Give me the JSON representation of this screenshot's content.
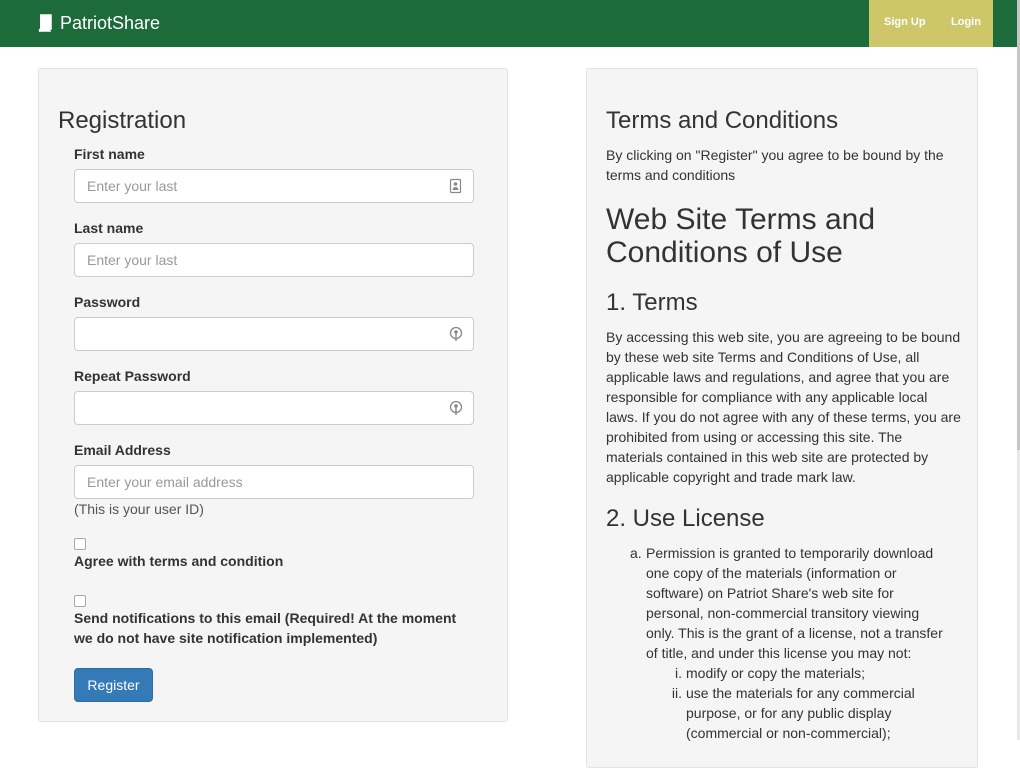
{
  "navbar": {
    "brand": "PatriotShare",
    "signup_label": "Sign Up",
    "login_label": "Login"
  },
  "registration": {
    "title": "Registration",
    "first_name_label": "First name",
    "first_name_placeholder": "Enter your last",
    "last_name_label": "Last name",
    "last_name_placeholder": "Enter your last",
    "password_label": "Password",
    "repeat_password_label": "Repeat Password",
    "email_label": "Email Address",
    "email_placeholder": "Enter your email address",
    "email_help": "(This is your user ID)",
    "agree_label": "Agree with terms and condition",
    "notify_label": "Send notifications to this email (Required! At the moment we do not have site notification implemented)",
    "register_label": "Register"
  },
  "terms": {
    "title": "Terms and Conditions",
    "intro": "By clicking on \"Register\" you agree to be bound by the terms and conditions",
    "heading": "Web Site Terms and Conditions of Use",
    "section1_title": "1. Terms",
    "section1_text": "By accessing this web site, you are agreeing to be bound by these web site Terms and Conditions of Use, all applicable laws and regulations, and agree that you are responsible for compliance with any applicable local laws. If you do not agree with any of these terms, you are prohibited from using or accessing this site. The materials contained in this web site are protected by applicable copyright and trade mark law.",
    "section2_title": "2. Use License",
    "license_item_marker": "a.",
    "license_item_text": "Permission is granted to temporarily download one copy of the materials (information or software) on Patriot Share's web site for personal, non-commercial transitory viewing only. This is the grant of a license, not a transfer of title, and under this license you may not:",
    "subitems": [
      {
        "marker": "i.",
        "text": "modify or copy the materials;"
      },
      {
        "marker": "ii.",
        "text": "use the materials for any commercial purpose, or for any public display (commercial or non-commercial);"
      }
    ]
  },
  "colors": {
    "navbar_bg": "#1d6a3a",
    "nav_right_bg": "#cdc76a",
    "button_primary": "#337ab7",
    "panel_bg": "#f5f5f5"
  }
}
